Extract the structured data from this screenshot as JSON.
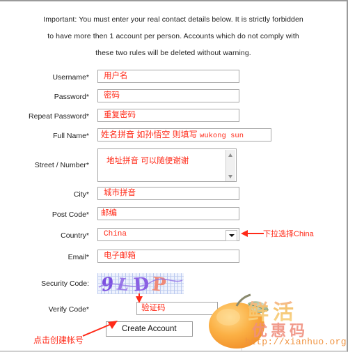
{
  "notice": {
    "line1": "Important: You must enter your real contact details below. It is strictly forbidden",
    "line2": "to have more then 1 account per person. Accounts which do not comply with",
    "line3": "these two rules will be deleted without warning."
  },
  "form": {
    "fields": [
      {
        "label": "Username*",
        "value": "用户名"
      },
      {
        "label": "Password*",
        "value": "密码"
      },
      {
        "label": "Repeat Password*",
        "value": "重复密码"
      },
      {
        "label": "Full Name*",
        "value": "姓名拼音 如孙悟空 则填写 ",
        "value_suffix": "wukong sun"
      },
      {
        "label": "Street / Number*",
        "value": "地址拼音 可以随便谢谢"
      },
      {
        "label": "City*",
        "value": "城市拼音"
      },
      {
        "label": "Post Code*",
        "value": "邮编"
      },
      {
        "label": "Country*",
        "value": "China"
      },
      {
        "label": "Email*",
        "value": "电子邮箱"
      },
      {
        "label": "Security Code:",
        "value": "9LDP"
      },
      {
        "label": "Verify Code*",
        "value": "验证码"
      }
    ],
    "submit_label": "Create Account",
    "captcha_text": "9LDP"
  },
  "annotations": {
    "country": "下拉选择China",
    "create": "点击创建帐号"
  },
  "logo": {
    "brand": "鲜活",
    "sub": "优惠码",
    "url": "http://xianhuo.org"
  },
  "colors": {
    "annotation_red": "#ff2a18",
    "input_text_red": "#ff2a18",
    "label_dark": "#1b1b1b",
    "border_gray": "#a6a6a6",
    "captcha_bg": "#eef2fd",
    "captcha_letter_purple": "#7b4fe0",
    "captcha_letter_salmon": "#f08a78",
    "logo_orange": "#f09340"
  }
}
